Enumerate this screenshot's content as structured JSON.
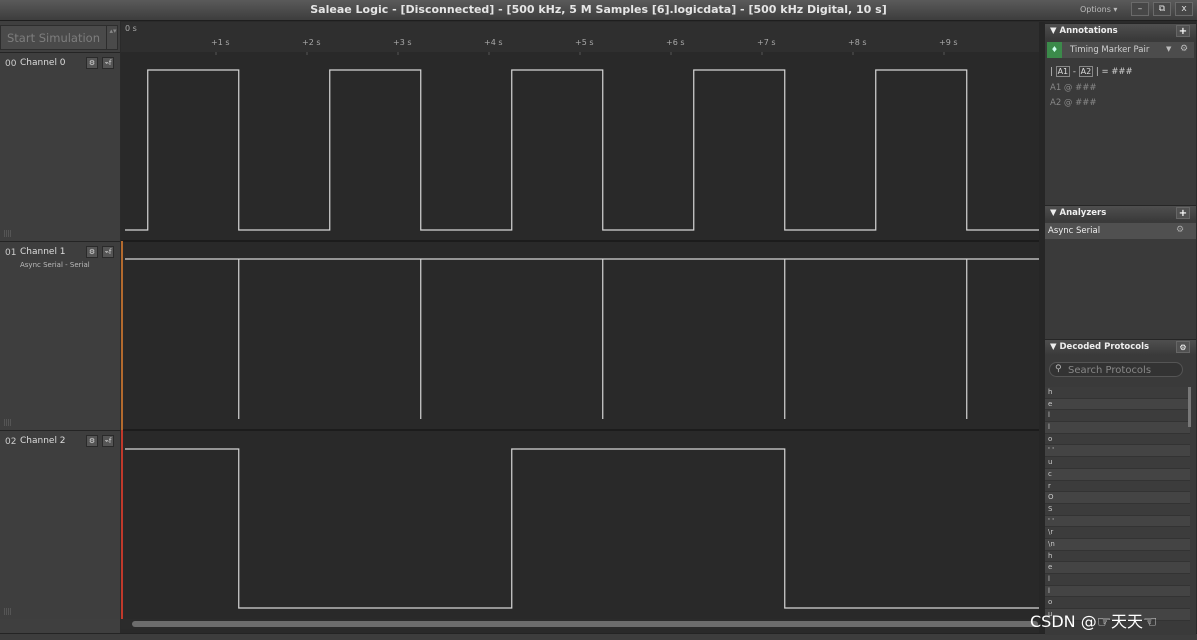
{
  "window": {
    "title": "Saleae Logic - [Disconnected] - [500 kHz, 5 M Samples [6].logicdata] - [500 kHz Digital, 10 s]",
    "options_label": "Options ▾",
    "minimize_label": "–",
    "restore_label": "⧉",
    "close_label": "x"
  },
  "toolbar": {
    "start_simulation_label": "Start Simulation",
    "spinner_label": "▴▾"
  },
  "ruler": {
    "origin_label": "0 s",
    "ticks": [
      "+1 s",
      "+2 s",
      "+3 s",
      "+4 s",
      "+5 s",
      "+6 s",
      "+7 s",
      "+8 s",
      "+9 s"
    ]
  },
  "channels": [
    {
      "num": "00",
      "name": "Channel 0",
      "sub": ""
    },
    {
      "num": "01",
      "name": "Channel 1",
      "sub": "Async Serial - Serial"
    },
    {
      "num": "02",
      "name": "Channel 2",
      "sub": ""
    }
  ],
  "channel_buttons": {
    "gear": "⚙",
    "trigger": "⌁f"
  },
  "signals": {
    "time_range": [
      0,
      10
    ],
    "channel0_toggle_times": [
      0.25,
      1.25,
      2.25,
      3.25,
      4.25,
      5.25,
      6.25,
      7.25,
      8.25,
      9.25
    ],
    "channel1_pulse_times": [
      1.25,
      3.25,
      5.25,
      7.25,
      9.25
    ],
    "channel2_toggle_times": [
      1.25,
      4.25,
      7.25
    ],
    "channel2_initial": "high"
  },
  "annotations": {
    "title": "Annotations",
    "add": "+",
    "marker_label": "Timing Marker Pair",
    "marker_flag": "♦",
    "dropdown": "▼",
    "gear": "⚙",
    "line1": {
      "prefix": "|",
      "a1": "A1",
      "dash": "-",
      "a2": "A2",
      "suffix": "| = ###"
    },
    "line2": "A1  @  ###",
    "line3": "A2  @  ###"
  },
  "analyzers": {
    "title": "Analyzers",
    "add": "+",
    "items": [
      "Async Serial"
    ],
    "gear": "⚙"
  },
  "decoded_protocols": {
    "title": "Decoded Protocols",
    "gear": "⚙",
    "search_placeholder": "Search Protocols",
    "search_icon": "⚲",
    "rows": [
      "h",
      "e",
      "l",
      "l",
      "o",
      "' '",
      "u",
      "c",
      "r",
      "O",
      "S",
      "' '",
      "\\r",
      "\\n",
      "h",
      "e",
      "l",
      "l",
      "o",
      "u"
    ]
  },
  "watermark": "CSDN @☞天天☜"
}
